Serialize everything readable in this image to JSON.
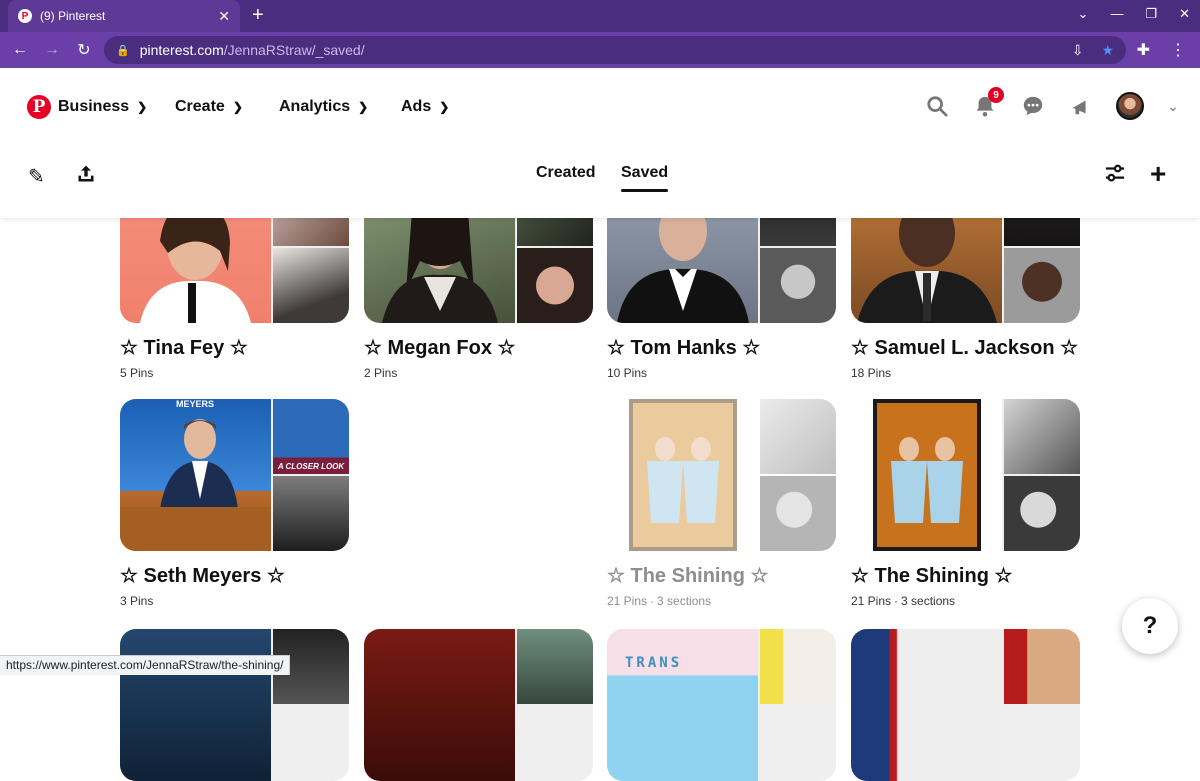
{
  "browser": {
    "tab_title": "(9) Pinterest",
    "url_host": "pinterest.com",
    "url_path": "/JennaRStraw/_saved/",
    "status_url": "https://www.pinterest.com/JennaRStraw/the-shining/"
  },
  "header": {
    "logo": "P",
    "nav": [
      {
        "label": "Business"
      },
      {
        "label": "Create"
      },
      {
        "label": "Analytics"
      },
      {
        "label": "Ads"
      }
    ],
    "notification_count": "9"
  },
  "profile_tabs": {
    "created": "Created",
    "saved": "Saved",
    "active": "Saved"
  },
  "boards": [
    {
      "name": "☆ Tina Fey ☆",
      "meta": "5 Pins",
      "sections": ""
    },
    {
      "name": "☆ Megan Fox ☆",
      "meta": "2 Pins",
      "sections": ""
    },
    {
      "name": "☆ Tom Hanks ☆",
      "meta": "10 Pins",
      "sections": ""
    },
    {
      "name": "☆ Samuel L. Jackson ☆",
      "meta": "18 Pins",
      "sections": ""
    },
    {
      "name": "☆ Seth Meyers ☆",
      "meta": "3 Pins",
      "sections": ""
    },
    {
      "name": "☆ The Shining ☆",
      "meta": "21 Pins",
      "sections": "3 sections"
    },
    {
      "name": "☆ The Shining ☆",
      "meta": "21 Pins",
      "sections": "3 sections"
    }
  ],
  "image_labels": {
    "seth_meyers_banner": "MEYERS",
    "closer_look": "A CLOSER LOOK",
    "trans_sign": "TRANS"
  },
  "help_label": "?"
}
